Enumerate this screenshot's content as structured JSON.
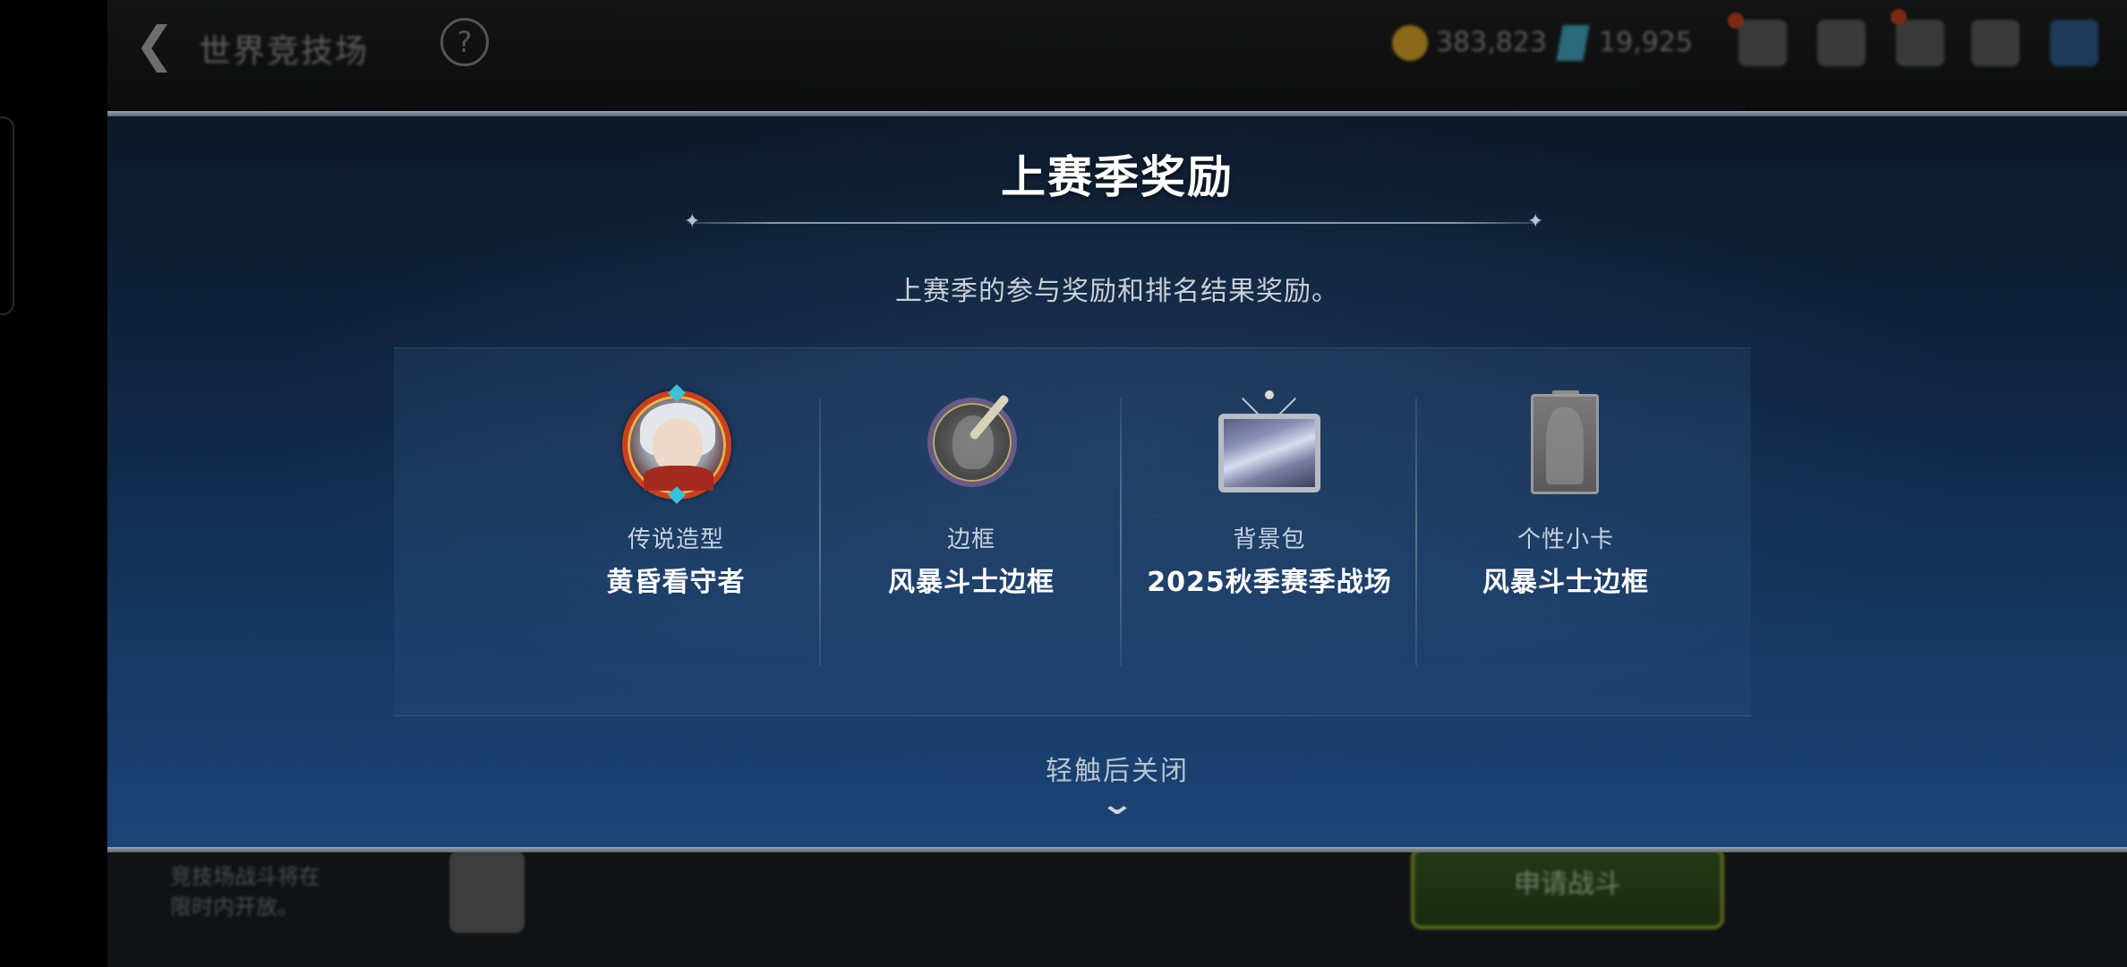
{
  "background_ui": {
    "back_label": "世界竞技场",
    "currencies": [
      {
        "icon": "gold-coin-icon",
        "value": "383,823"
      },
      {
        "icon": "crystal-icon",
        "value": "19,925"
      }
    ],
    "bottom_left_text": "竞技场战斗将在\n限时内开放。",
    "bottom_button_label": "申请战斗"
  },
  "modal": {
    "title": "上赛季奖励",
    "description": "上赛季的参与奖励和排名结果奖励。",
    "rewards": [
      {
        "type": "传说造型",
        "name": "黄昏看守者",
        "icon": "legendary-costume-portrait-icon"
      },
      {
        "type": "边框",
        "name": "风暴斗士边框",
        "icon": "storm-fighter-frame-icon"
      },
      {
        "type": "背景包",
        "name": "2025秋季赛季战场",
        "icon": "background-pack-picture-icon"
      },
      {
        "type": "个性小卡",
        "name": "风暴斗士边框",
        "icon": "personal-card-icon"
      }
    ],
    "close_hint": "轻触后关闭"
  },
  "colors": {
    "modal_top": "#0c1928",
    "modal_bottom": "#1b4577",
    "title": "#ffffff",
    "accent_border": "#9aa3ad"
  }
}
